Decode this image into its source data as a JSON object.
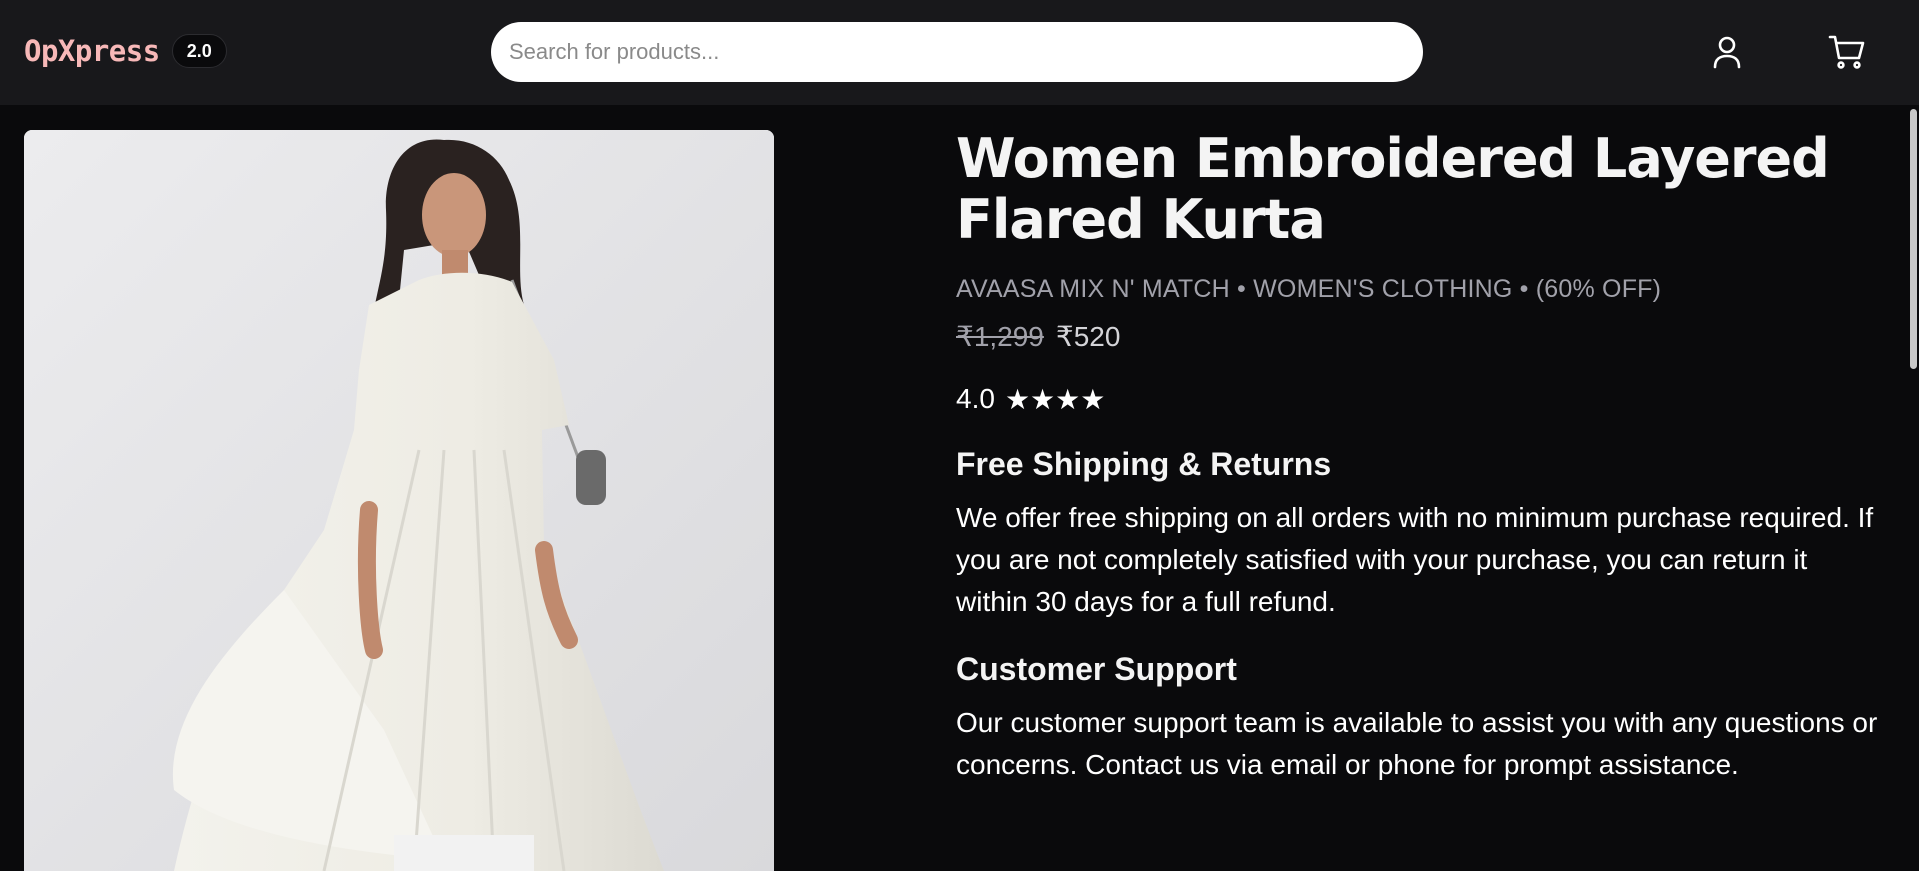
{
  "header": {
    "brand": "OpXpress",
    "version": "2.0",
    "search_placeholder": "Search for products..."
  },
  "icons": {
    "user": "user-icon",
    "cart": "cart-icon"
  },
  "product": {
    "image_alt": "Women Embroidered Layered Flared Kurta",
    "title": "Women Embroidered Layered Flared Kurta",
    "meta": "AVAASA MIX N' MATCH • WOMEN'S CLOTHING • (60% OFF)",
    "price_original": "₹1,299",
    "price_sale": "₹520",
    "rating_value": "4.0",
    "rating_stars": "★★★★"
  },
  "info": {
    "shipping_title": "Free Shipping & Returns",
    "shipping_text": "We offer free shipping on all orders with no minimum purchase required. If you are not completely satisfied with your purchase, you can return it within 30 days for a full refund.",
    "support_title": "Customer Support",
    "support_text": "Our customer support team is available to assist you with any questions or concerns. Contact us via email or phone for prompt assistance."
  },
  "colors": {
    "background": "#0a0a0c",
    "header": "#18181b",
    "brand": "#f7b8b8",
    "muted_text": "#a1a1aa"
  }
}
